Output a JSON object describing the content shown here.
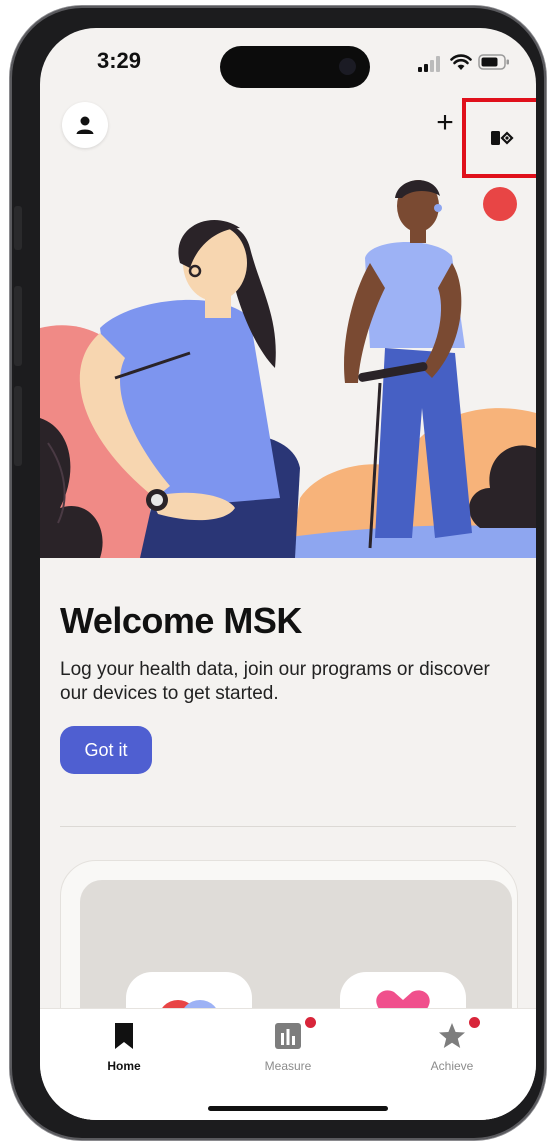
{
  "status_bar": {
    "time": "3:29"
  },
  "header": {
    "avatar_icon": "person-icon",
    "add_icon": "plus-icon",
    "add_symbol": "+",
    "device_icon": "device-sync-icon",
    "highlight_color": "#e0101b"
  },
  "welcome": {
    "title": "Welcome MSK",
    "description": "Log your health data, join our programs or discover our devices to get started.",
    "button_label": "Got it"
  },
  "tabs": [
    {
      "label": "Home",
      "icon": "bookmark-home-icon",
      "active": true
    },
    {
      "label": "Measure",
      "icon": "bar-chart-icon",
      "badge": true
    },
    {
      "label": "Achieve",
      "icon": "star-icon",
      "badge": true
    }
  ],
  "colors": {
    "accent": "#4f5fd1",
    "badge": "#d8253a",
    "background": "#f4f2f0"
  }
}
